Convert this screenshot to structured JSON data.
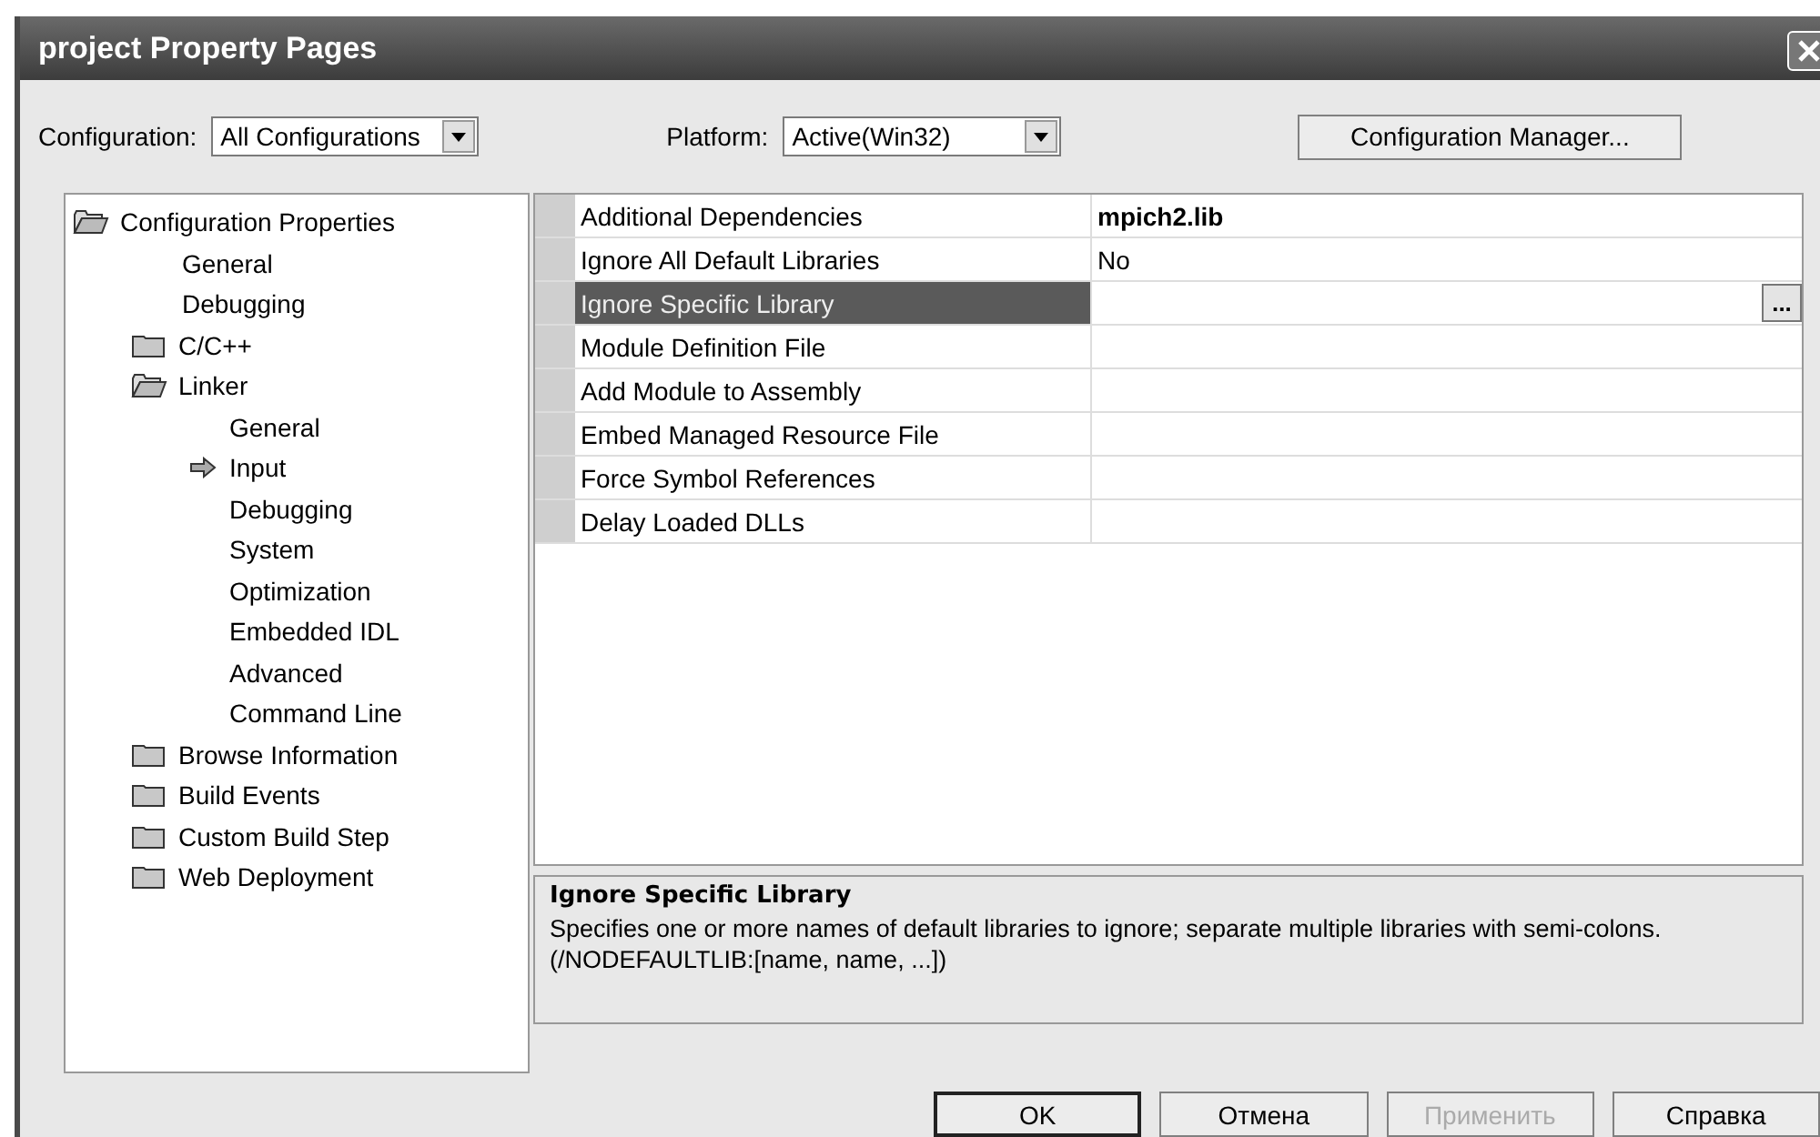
{
  "window": {
    "title": "project Property Pages"
  },
  "toolbar": {
    "configuration_label": "Configuration:",
    "configuration_value": "All Configurations",
    "platform_label": "Platform:",
    "platform_value": "Active(Win32)",
    "manager_button": "Configuration Manager..."
  },
  "tree": [
    {
      "label": "Configuration Properties",
      "kind": "folder",
      "expanded": true,
      "children": [
        {
          "label": "General",
          "kind": "page",
          "selected": false
        },
        {
          "label": "Debugging",
          "kind": "page",
          "selected": false
        },
        {
          "label": "C/C++",
          "kind": "folder",
          "expanded": false
        },
        {
          "label": "Linker",
          "kind": "folder",
          "expanded": true,
          "children": [
            {
              "label": "General",
              "kind": "page",
              "selected": false
            },
            {
              "label": "Input",
              "kind": "page",
              "selected": true
            },
            {
              "label": "Debugging",
              "kind": "page",
              "selected": false
            },
            {
              "label": "System",
              "kind": "page",
              "selected": false
            },
            {
              "label": "Optimization",
              "kind": "page",
              "selected": false
            },
            {
              "label": "Embedded IDL",
              "kind": "page",
              "selected": false
            },
            {
              "label": "Advanced",
              "kind": "page",
              "selected": false
            },
            {
              "label": "Command Line",
              "kind": "page",
              "selected": false
            }
          ]
        },
        {
          "label": "Browse Information",
          "kind": "folder",
          "expanded": false
        },
        {
          "label": "Build Events",
          "kind": "folder",
          "expanded": false
        },
        {
          "label": "Custom Build Step",
          "kind": "folder",
          "expanded": false
        },
        {
          "label": "Web Deployment",
          "kind": "folder",
          "expanded": false
        }
      ]
    }
  ],
  "grid": {
    "rows": [
      {
        "name": "Additional Dependencies",
        "value": "mpich2.lib",
        "modified": true,
        "selected": false
      },
      {
        "name": "Ignore All Default Libraries",
        "value": "No",
        "modified": false,
        "selected": false
      },
      {
        "name": "Ignore Specific Library",
        "selected": true,
        "button": "..."
      },
      {
        "name": "Module Definition File",
        "selected": false
      },
      {
        "name": "Add Module to Assembly",
        "selected": false
      },
      {
        "name": "Embed Managed Resource File",
        "selected": false
      },
      {
        "name": "Force Symbol References",
        "selected": false
      },
      {
        "name": "Delay Loaded DLLs",
        "selected": false
      }
    ]
  },
  "description": {
    "title": "Ignore Specific Library",
    "text": "Specifies one or more names of default libraries to ignore; separate multiple libraries with semi-colons.     (/NODEFAULTLIB:[name, name, ...])"
  },
  "buttons": [
    {
      "label": "OK",
      "default": true,
      "disabled": false
    },
    {
      "label": "Отмена",
      "default": false,
      "disabled": false
    },
    {
      "label": "Применить",
      "default": false,
      "disabled": true
    },
    {
      "label": "Справка",
      "default": false,
      "disabled": false
    }
  ]
}
